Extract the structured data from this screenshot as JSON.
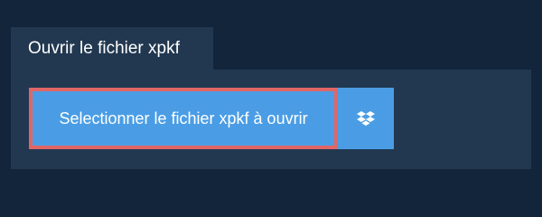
{
  "tab": {
    "label": "Ouvrir le fichier xpkf"
  },
  "upload": {
    "select_button_label": "Selectionner le fichier xpkf à ouvrir",
    "dropbox_icon": "dropbox-icon"
  },
  "colors": {
    "background": "#13253b",
    "panel": "#223850",
    "button": "#4a9de5",
    "highlight_border": "#e06666"
  }
}
